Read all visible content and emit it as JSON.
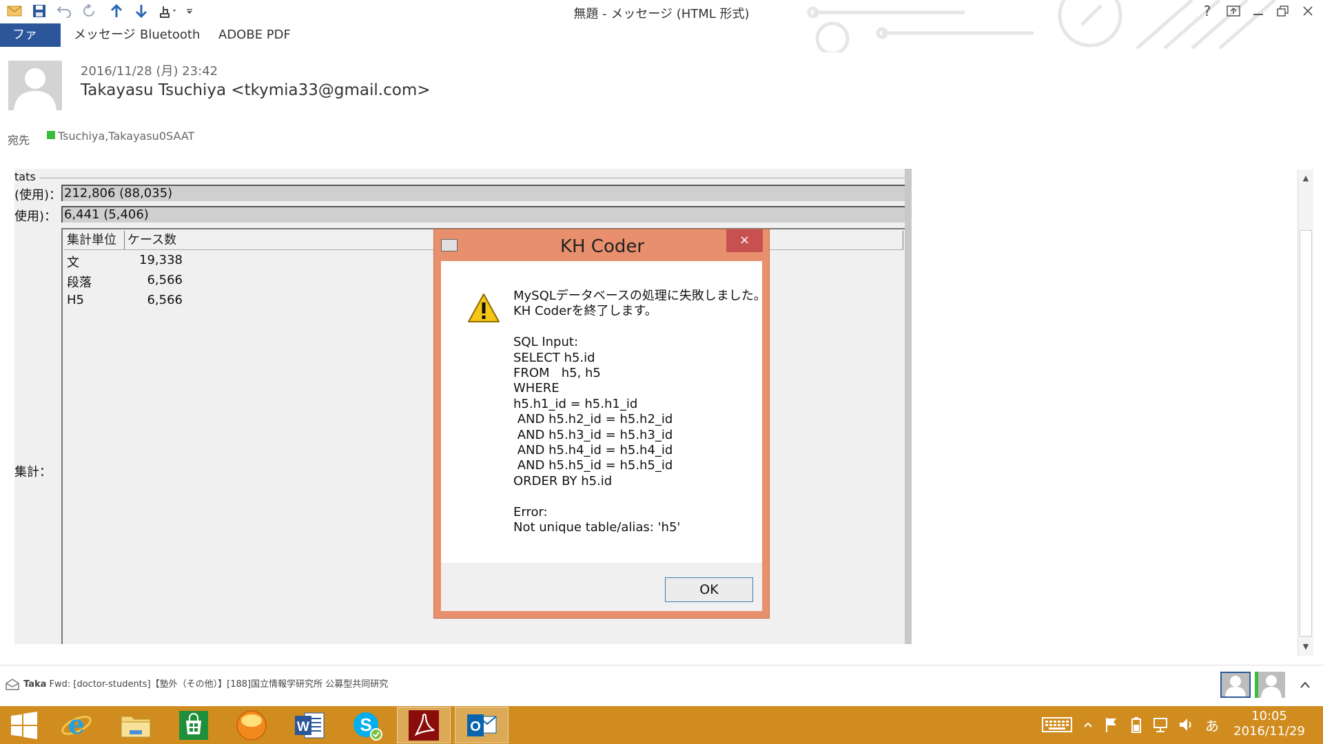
{
  "window": {
    "title": "無題 - メッセージ (HTML 形式)",
    "help": "?"
  },
  "ribbon": {
    "tabs": [
      "ファイル",
      "メッセージ",
      "Bluetooth",
      "ADOBE PDF"
    ]
  },
  "message": {
    "date": "2016/11/28 (月) 23:42",
    "from": "Takayasu Tsuchiya <tkymia33@gmail.com>",
    "to_label": "宛先",
    "to": "Tsuchiya,Takayasu0SAAT"
  },
  "capture": {
    "stats_label": "tats",
    "row1_label": "(使用)：",
    "row1_value": "212,806 (88,035)",
    "row2_label": "使用)：",
    "row2_value": "6,441 (5,406)",
    "table_headers": [
      "集計単位",
      "ケース数"
    ],
    "rows": [
      {
        "unit": "文",
        "count": "19,338"
      },
      {
        "unit": "段落",
        "count": "6,566"
      },
      {
        "unit": "H5",
        "count": "6,566"
      }
    ],
    "total_label": "集計："
  },
  "dialog": {
    "title": "KH Coder",
    "close": "×",
    "message": "MySQLデータベースの処理に失敗しました。\nKH Coderを終了します。\n\nSQL Input:\nSELECT h5.id\nFROM   h5, h5\nWHERE\nh5.h1_id = h5.h1_id\n AND h5.h2_id = h5.h2_id\n AND h5.h3_id = h5.h3_id\n AND h5.h4_id = h5.h4_id\n AND h5.h5_id = h5.h5_id\nORDER BY h5.id\n\nError:\nNot unique table/alias: 'h5'",
    "ok_label": "OK"
  },
  "people_bar": {
    "sender": "Taka",
    "subject": "Fwd: [doctor-students]【塾外（その他）】[188]国立情報学研究所  公募型共同研究"
  },
  "taskbar": {
    "time": "10:05",
    "date": "2016/11/29",
    "ime": "あ",
    "apps": [
      "start-icon",
      "ie-icon",
      "file-explorer-icon",
      "store-icon",
      "media-player-icon",
      "word-icon",
      "skype-icon",
      "acrobat-icon",
      "outlook-icon"
    ]
  },
  "colors": {
    "accent": "#2b579a",
    "taskbar": "#d08c1e",
    "dialog_frame": "#e8906e",
    "close_button": "#c75050",
    "recipient_status": "#3cbc3c"
  }
}
